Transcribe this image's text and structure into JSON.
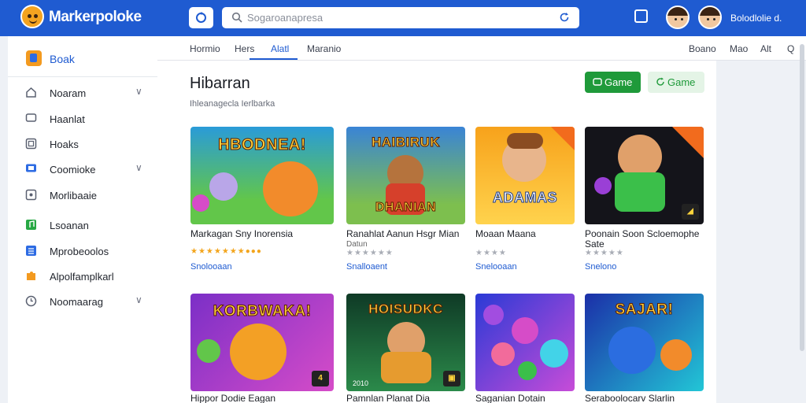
{
  "header": {
    "brand": "Markerpoloke",
    "search_placeholder": "Sogaroanapresa",
    "user_name": "Bolodlolie d."
  },
  "sidebar": {
    "head_label": "Boak",
    "items": [
      {
        "label": "Noaram",
        "icon": "house-icon",
        "has_chevron": true
      },
      {
        "label": "Haanlat",
        "icon": "chat-icon",
        "has_chevron": false
      },
      {
        "label": "Hoaks",
        "icon": "window-icon",
        "has_chevron": false
      },
      {
        "label": "Coomioke",
        "icon": "monitor-icon",
        "has_chevron": true
      },
      {
        "label": "Morlibaaie",
        "icon": "screen-icon",
        "has_chevron": false
      },
      {
        "label": "Lsoanan",
        "icon": "music-icon",
        "has_chevron": false
      },
      {
        "label": "Mprobeoolos",
        "icon": "list-icon",
        "has_chevron": false
      },
      {
        "label": "Alpolfamplkarl",
        "icon": "puzzle-icon",
        "has_chevron": false
      },
      {
        "label": "Noomaarag",
        "icon": "clock-icon",
        "has_chevron": true
      }
    ],
    "chevron_glyph": "∨"
  },
  "tabs": {
    "left": [
      "Hormio",
      "Hers",
      "Alatl",
      "Maranio"
    ],
    "active": "Alatl",
    "right": [
      "Boano",
      "Mao",
      "Alt",
      "Q"
    ],
    "close_glyph": "×"
  },
  "main": {
    "title": "Hibarran",
    "subtitle": "Ihleanagecla Ierlbarka",
    "btn_primary": "Game",
    "btn_secondary": "Game"
  },
  "cards": [
    {
      "art_text": "HBODNEA!",
      "title": "Markagan Sny Inorensia",
      "rating": "★★★★★★★●●●",
      "link": "Snolooaan",
      "theme": [
        "#2a9bd8",
        "#62c64a"
      ],
      "accent": "#f28b2b"
    },
    {
      "art_text": "HAIBIRUK",
      "title": "Ranahlat Aanun Hsgr Mian",
      "subtitle_line": "Datun",
      "rating": "★★★★★★",
      "link": "Snalloaent",
      "theme": [
        "#3a84d6",
        "#7dbf4e"
      ],
      "accent": "#d6402b",
      "art_text2": "DHANIAN"
    },
    {
      "art_text": "ADAMAS",
      "title": "Moaan Maana",
      "rating": "★★★★",
      "link": "Snelooaan",
      "theme": [
        "#f7a21b",
        "#ffd34d"
      ],
      "accent": "#8a4c22"
    },
    {
      "art_text": "",
      "title": "Poonain Soon Scloemophe",
      "subtitle_line": "Sate",
      "rating": "★★★★★",
      "link": "Snelono",
      "theme": [
        "#0e0e14",
        "#2a2a32"
      ],
      "accent": "#3bbf4a"
    },
    {
      "art_text": "KORBWAKA!",
      "title": "Hippor Dodie Eagan",
      "rating": "",
      "link": "",
      "theme": [
        "#7b2fc7",
        "#d64cc8"
      ],
      "accent": "#f3a025"
    },
    {
      "art_text": "HOISUDKC",
      "title": "Pamnlan Planat Dia",
      "rating": "",
      "link": "",
      "theme": [
        "#0f3a26",
        "#2b8a4a"
      ],
      "accent": "#e69b2f",
      "corner_text": "2010"
    },
    {
      "art_text": "",
      "title": "Saganian Dotain",
      "rating": "",
      "link": "",
      "theme": [
        "#2a3ad6",
        "#c74cd8"
      ],
      "accent": "#42d3e8"
    },
    {
      "art_text": "SAJAR!",
      "title": "Seraboolocarv Slarlin",
      "rating": "",
      "link": "",
      "theme": [
        "#1b2fa8",
        "#22c6d6"
      ],
      "accent": "#f28b2b"
    }
  ]
}
